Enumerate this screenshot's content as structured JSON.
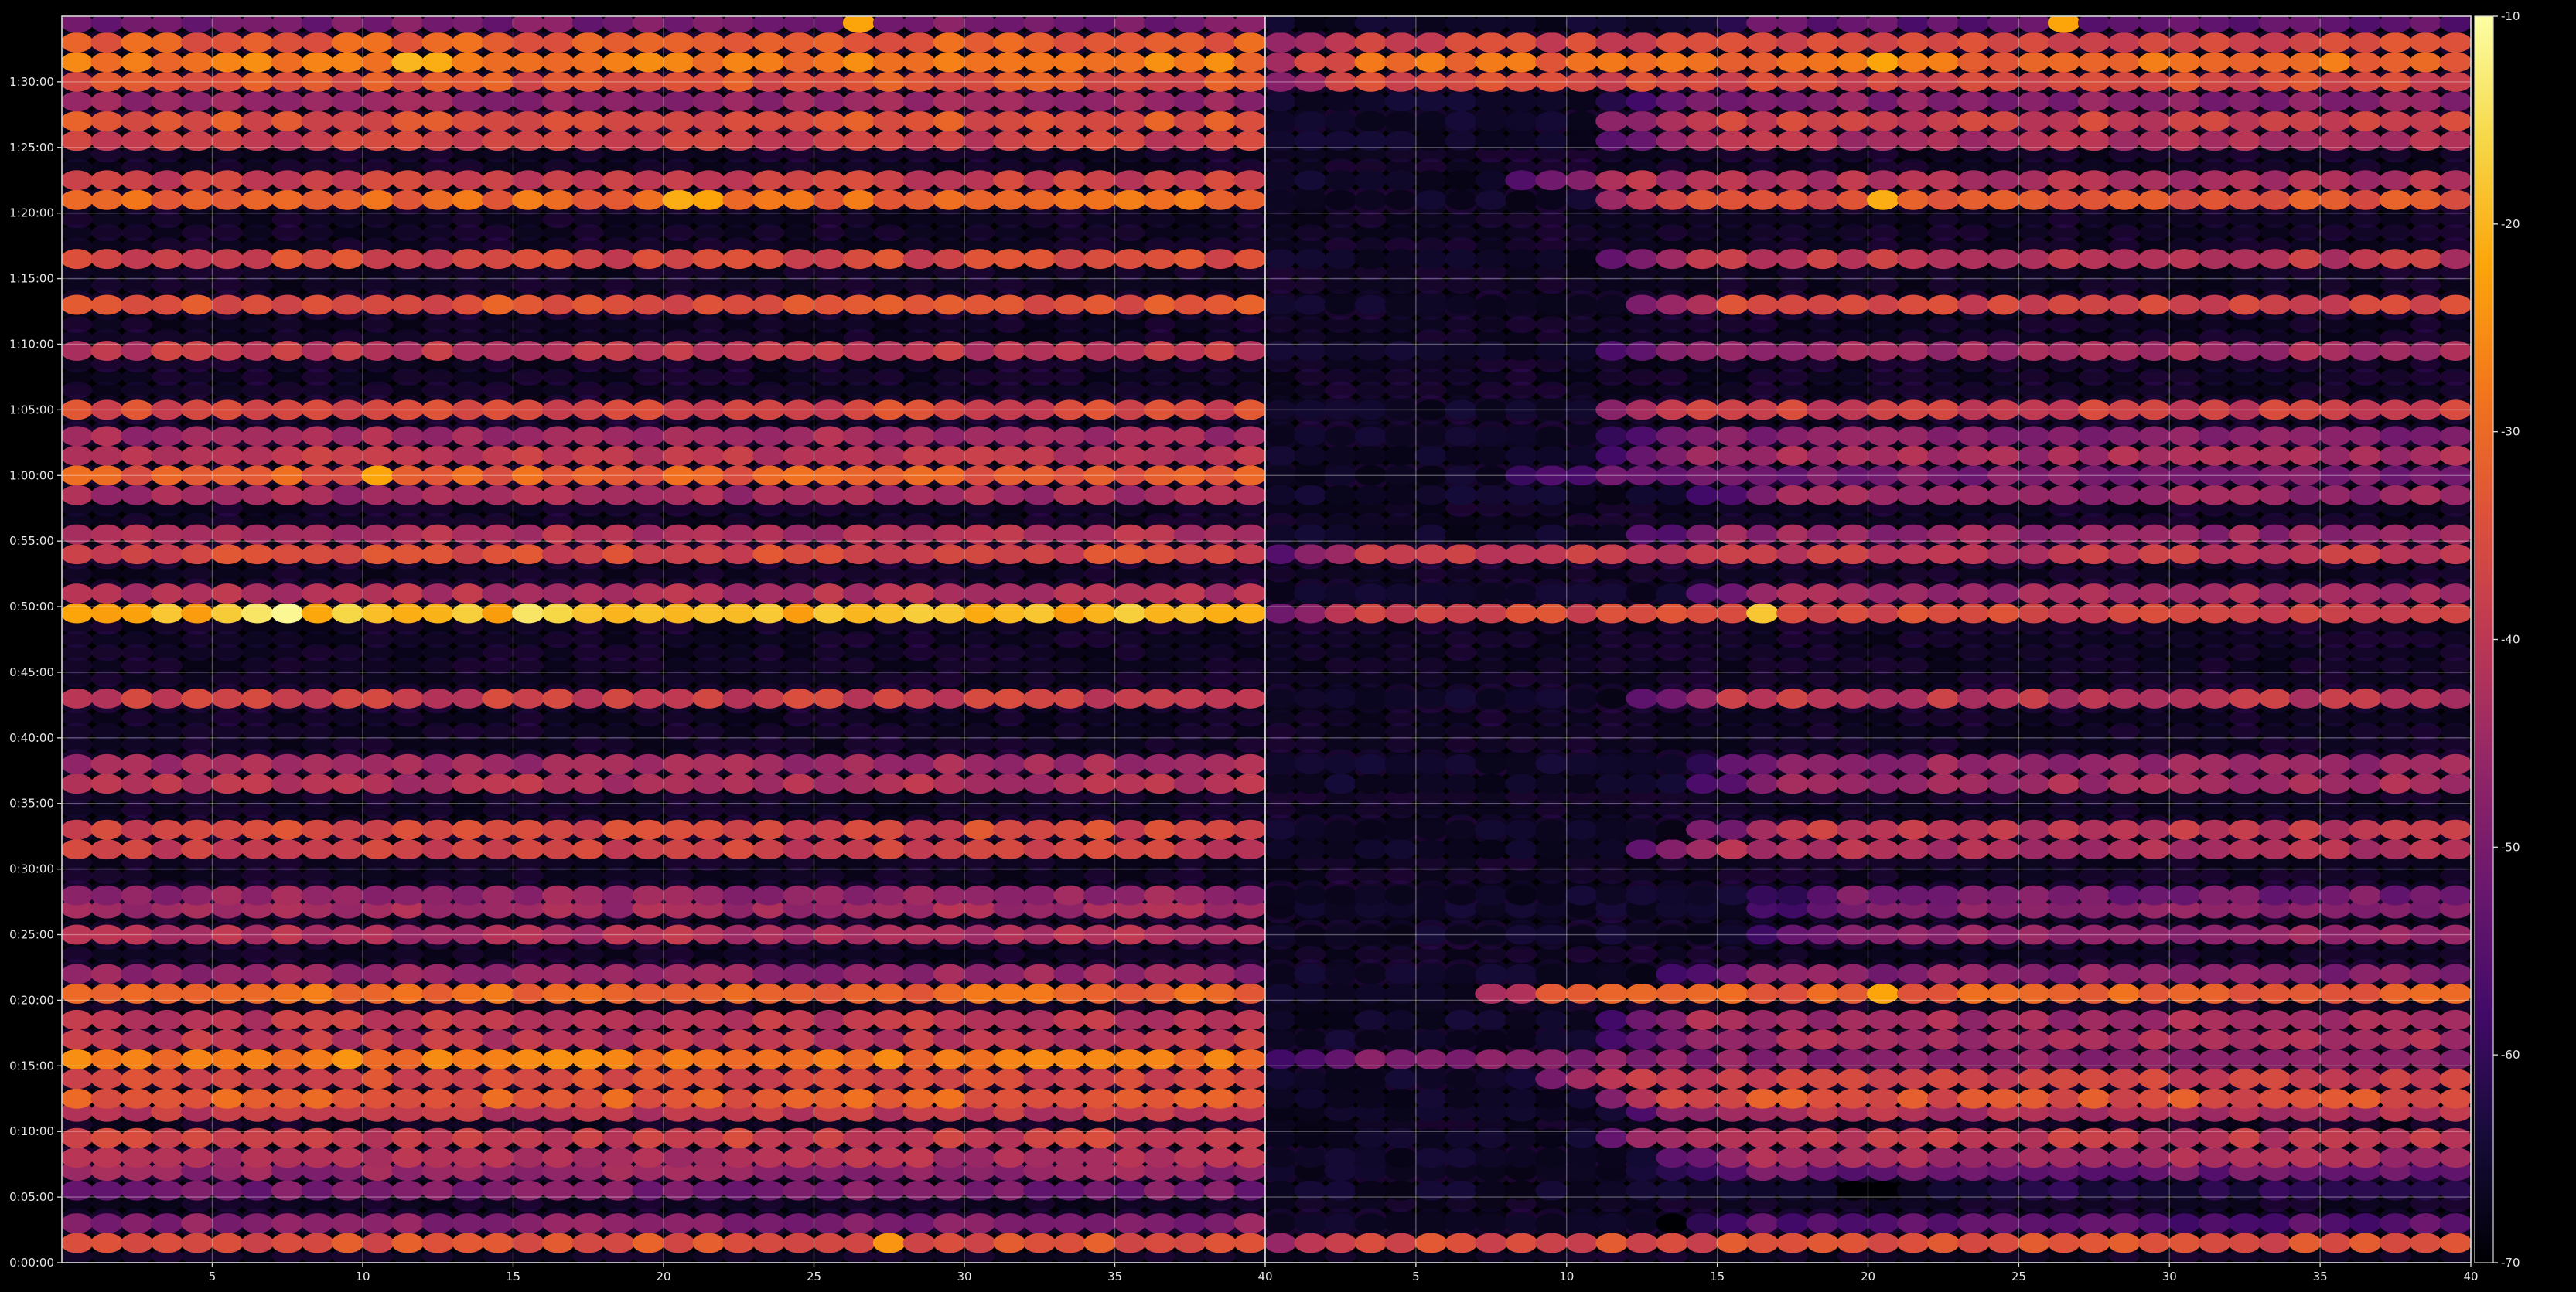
{
  "chart_data": {
    "type": "heatmap",
    "title": "",
    "xlabel": "",
    "ylabel": "",
    "colormap": "inferno",
    "background_color": "#000000",
    "grid": true,
    "panels": [
      {
        "name": "",
        "x_range": [
          1,
          40
        ],
        "x_ticks": [
          5,
          10,
          15,
          20,
          25,
          30,
          35,
          40
        ],
        "x_tick_labels": [
          "5",
          "10",
          "15",
          "20",
          "25",
          "30",
          "35",
          "40"
        ]
      },
      {
        "name": "",
        "x_range": [
          1,
          40
        ],
        "x_ticks": [
          5,
          10,
          15,
          20,
          25,
          30,
          35,
          40
        ],
        "x_tick_labels": [
          "5",
          "10",
          "15",
          "20",
          "25",
          "30",
          "35",
          "40"
        ]
      }
    ],
    "y_range_seconds": [
      0,
      5700
    ],
    "y_ticks_seconds": [
      0,
      300,
      600,
      900,
      1200,
      1500,
      1800,
      2100,
      2400,
      2700,
      3000,
      3300,
      3600,
      3900,
      4200,
      4500,
      4800,
      5100,
      5400
    ],
    "y_tick_labels": [
      "0:00:00",
      "0:05:00",
      "0:10:00",
      "0:15:00",
      "0:20:00",
      "0:25:00",
      "0:30:00",
      "0:35:00",
      "0:40:00",
      "0:45:00",
      "0:50:00",
      "0:55:00",
      "1:00:00",
      "1:05:00",
      "1:10:00",
      "1:15:00",
      "1:20:00",
      "1:25:00",
      "1:30:00"
    ],
    "colorbar": {
      "range": [
        -70,
        -10
      ],
      "ticks": [
        -70,
        -60,
        -50,
        -40,
        -30,
        -20,
        -10
      ],
      "tick_labels": [
        "-70",
        "-60",
        "-50",
        "-40",
        "-30",
        "-20",
        "-10"
      ]
    },
    "bands": [
      {
        "t": 90,
        "left": -34,
        "right": -35,
        "right_start": 1
      },
      {
        "t": 180,
        "left": -48,
        "right": -55,
        "right_start": 14
      },
      {
        "t": 330,
        "left": -50,
        "right": -62,
        "right_start": 20
      },
      {
        "t": 420,
        "left": -46,
        "right": -52,
        "right_start": 14
      },
      {
        "t": 480,
        "left": -42,
        "right": -44,
        "right_start": 14
      },
      {
        "t": 570,
        "left": -38,
        "right": -40,
        "right_start": 12
      },
      {
        "t": 690,
        "left": -40,
        "right": -42,
        "right_start": 13
      },
      {
        "t": 750,
        "left": -32,
        "right": -34,
        "right_start": 12
      },
      {
        "t": 840,
        "left": -36,
        "right": -38,
        "right_start": 10
      },
      {
        "t": 930,
        "left": -28,
        "right": -48,
        "right_start": 1
      },
      {
        "t": 1020,
        "left": -40,
        "right": -44,
        "right_start": 12
      },
      {
        "t": 1110,
        "left": -40,
        "right": -44,
        "right_start": 12
      },
      {
        "t": 1230,
        "left": -30,
        "right": -32,
        "right_start": 8
      },
      {
        "t": 1320,
        "left": -46,
        "right": -48,
        "right_start": 14
      },
      {
        "t": 1500,
        "left": -42,
        "right": -46,
        "right_start": 17
      },
      {
        "t": 1620,
        "left": -44,
        "right": -48,
        "right_start": 17
      },
      {
        "t": 1680,
        "left": -46,
        "right": -50,
        "right_start": 17
      },
      {
        "t": 1890,
        "left": -38,
        "right": -42,
        "right_start": 13
      },
      {
        "t": 1980,
        "left": -36,
        "right": -40,
        "right_start": 15
      },
      {
        "t": 2190,
        "left": -42,
        "right": -44,
        "right_start": 15
      },
      {
        "t": 2280,
        "left": -44,
        "right": -46,
        "right_start": 15
      },
      {
        "t": 2580,
        "left": -38,
        "right": -40,
        "right_start": 13
      },
      {
        "t": 2970,
        "left": -20,
        "right": -36,
        "right_start": 1
      },
      {
        "t": 3060,
        "left": -42,
        "right": -44,
        "right_start": 15
      },
      {
        "t": 3240,
        "left": -36,
        "right": -40,
        "right_start": 1
      },
      {
        "t": 3330,
        "left": -42,
        "right": -46,
        "right_start": 13
      },
      {
        "t": 3510,
        "left": -44,
        "right": -46,
        "right_start": 15
      },
      {
        "t": 3600,
        "left": -32,
        "right": -50,
        "right_start": 9
      },
      {
        "t": 3690,
        "left": -40,
        "right": -44,
        "right_start": 12
      },
      {
        "t": 3780,
        "left": -44,
        "right": -48,
        "right_start": 12
      },
      {
        "t": 3900,
        "left": -36,
        "right": -38,
        "right_start": 12
      },
      {
        "t": 4170,
        "left": -40,
        "right": -44,
        "right_start": 12
      },
      {
        "t": 4380,
        "left": -34,
        "right": -36,
        "right_start": 13
      },
      {
        "t": 4590,
        "left": -36,
        "right": -40,
        "right_start": 12
      },
      {
        "t": 4860,
        "left": -30,
        "right": -34,
        "right_start": 12
      },
      {
        "t": 4950,
        "left": -38,
        "right": -42,
        "right_start": 9
      },
      {
        "t": 5130,
        "left": -38,
        "right": -42,
        "right_start": 12
      },
      {
        "t": 5220,
        "left": -34,
        "right": -38,
        "right_start": 12
      },
      {
        "t": 5310,
        "left": -46,
        "right": -48,
        "right_start": 12
      },
      {
        "t": 5400,
        "left": -34,
        "right": -36,
        "right_start": 1
      },
      {
        "t": 5490,
        "left": -28,
        "right": -30,
        "right_start": 1
      },
      {
        "t": 5580,
        "left": -32,
        "right": -36,
        "right_start": 1
      },
      {
        "t": 5670,
        "left": -50,
        "right": -54,
        "right_start": 14
      }
    ],
    "hotspots": [
      {
        "panel": 0,
        "t": 2970,
        "x": 7,
        "value": -14
      },
      {
        "panel": 0,
        "t": 2970,
        "x": 8,
        "value": -11
      },
      {
        "panel": 0,
        "t": 2970,
        "x": 10,
        "value": -16
      },
      {
        "panel": 0,
        "t": 2970,
        "x": 16,
        "value": -14
      },
      {
        "panel": 0,
        "t": 2970,
        "x": 17,
        "value": -16
      },
      {
        "panel": 0,
        "t": 5490,
        "x": 12,
        "value": -20
      },
      {
        "panel": 0,
        "t": 5490,
        "x": 13,
        "value": -21
      },
      {
        "panel": 0,
        "t": 4860,
        "x": 21,
        "value": -21
      },
      {
        "panel": 0,
        "t": 4860,
        "x": 22,
        "value": -22
      },
      {
        "panel": 0,
        "t": 4260,
        "x": 20,
        "value": -22
      },
      {
        "panel": 0,
        "t": 3600,
        "x": 11,
        "value": -22
      },
      {
        "panel": 0,
        "t": 930,
        "x": 10,
        "value": -24
      },
      {
        "panel": 0,
        "t": 540,
        "x": 21,
        "value": -23
      },
      {
        "panel": 0,
        "t": 90,
        "x": 28,
        "value": -24
      },
      {
        "panel": 0,
        "t": 5670,
        "x": 27,
        "value": -22
      },
      {
        "panel": 1,
        "t": 2970,
        "x": 17,
        "value": -18
      },
      {
        "panel": 1,
        "t": 4860,
        "x": 21,
        "value": -21
      },
      {
        "panel": 1,
        "t": 5490,
        "x": 21,
        "value": -22
      },
      {
        "panel": 1,
        "t": 5670,
        "x": 27,
        "value": -22
      },
      {
        "panel": 1,
        "t": 1230,
        "x": 21,
        "value": -22
      },
      {
        "panel": 1,
        "t": 2310,
        "x": 30,
        "value": -24
      }
    ]
  }
}
